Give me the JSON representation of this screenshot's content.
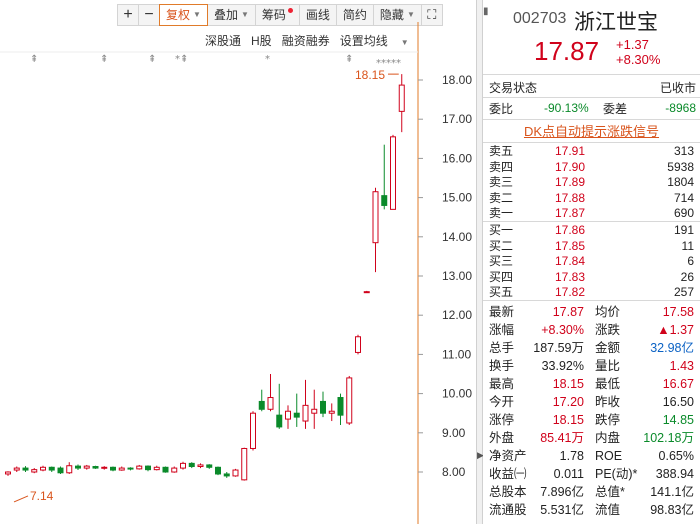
{
  "toolbar": {
    "plus": "+",
    "minus": "−",
    "fuquan": "复权",
    "diejia": "叠加",
    "choumao": "筹码",
    "huaxian": "画线",
    "jianyue": "简约",
    "yincang": "隐藏"
  },
  "subbar": {
    "shengang": "深股通",
    "hgu": "H股",
    "rongzi": "融资融券",
    "junxian": "设置均线"
  },
  "axis": {
    "labels": [
      "18.00",
      "17.00",
      "16.00",
      "15.00",
      "14.00",
      "13.00",
      "12.00",
      "11.00",
      "10.00",
      "9.00",
      "8.00"
    ]
  },
  "annotations": {
    "high": "18.15",
    "low": "7.14",
    "stars": "*****",
    "marks": [
      "⇞",
      "⇞",
      "⇞",
      "*⇞",
      "*",
      "⇞"
    ]
  },
  "header": {
    "code": "002703",
    "name": "浙江世宝",
    "price": "17.87",
    "change": "+1.37",
    "change_pct": "+8.30%"
  },
  "status": {
    "label": "交易状态",
    "value": "已收市"
  },
  "ratio": {
    "weibi_label": "委比",
    "weibi": "-90.13%",
    "weicha_label": "委差",
    "weicha": "-8968"
  },
  "dk_signal": "DK点自动提示涨跌信号",
  "sells": [
    {
      "label": "卖五",
      "price": "17.91",
      "vol": "313"
    },
    {
      "label": "卖四",
      "price": "17.90",
      "vol": "5938"
    },
    {
      "label": "卖三",
      "price": "17.89",
      "vol": "1804"
    },
    {
      "label": "卖二",
      "price": "17.88",
      "vol": "714"
    },
    {
      "label": "卖一",
      "price": "17.87",
      "vol": "690"
    }
  ],
  "buys": [
    {
      "label": "买一",
      "price": "17.86",
      "vol": "191"
    },
    {
      "label": "买二",
      "price": "17.85",
      "vol": "11"
    },
    {
      "label": "买三",
      "price": "17.84",
      "vol": "6"
    },
    {
      "label": "买四",
      "price": "17.83",
      "vol": "26"
    },
    {
      "label": "买五",
      "price": "17.82",
      "vol": "257"
    }
  ],
  "stats": [
    {
      "l1": "最新",
      "v1": "17.87",
      "c1": "red",
      "l2": "均价",
      "v2": "17.58",
      "c2": "red"
    },
    {
      "l1": "涨幅",
      "v1": "+8.30%",
      "c1": "red",
      "l2": "涨跌",
      "v2": "▲1.37",
      "c2": "red"
    },
    {
      "l1": "总手",
      "v1": "187.59万",
      "c1": "blk",
      "l2": "金额",
      "v2": "32.98亿",
      "c2": "blue"
    },
    {
      "l1": "换手",
      "v1": "33.92%",
      "c1": "blk",
      "l2": "量比",
      "v2": "1.43",
      "c2": "red"
    },
    {
      "l1": "最高",
      "v1": "18.15",
      "c1": "red",
      "l2": "最低",
      "v2": "16.67",
      "c2": "red"
    },
    {
      "l1": "今开",
      "v1": "17.20",
      "c1": "red",
      "l2": "昨收",
      "v2": "16.50",
      "c2": "blk"
    },
    {
      "l1": "涨停",
      "v1": "18.15",
      "c1": "red",
      "l2": "跌停",
      "v2": "14.85",
      "c2": "green"
    },
    {
      "l1": "外盘",
      "v1": "85.41万",
      "c1": "red",
      "l2": "内盘",
      "v2": "102.18万",
      "c2": "green"
    },
    {
      "l1": "净资产",
      "v1": "1.78",
      "c1": "blk",
      "l2": "ROE",
      "v2": "0.65%",
      "c2": "blk"
    },
    {
      "l1": "收益㈠",
      "v1": "0.011",
      "c1": "blk",
      "l2": "PE(动)*",
      "v2": "388.94",
      "c2": "blk"
    },
    {
      "l1": "总股本",
      "v1": "7.896亿",
      "c1": "blk",
      "l2": "总值*",
      "v2": "141.1亿",
      "c2": "blk"
    },
    {
      "l1": "流通股",
      "v1": "5.531亿",
      "c1": "blk",
      "l2": "流值",
      "v2": "98.83亿",
      "c2": "blk"
    }
  ],
  "candles": [
    {
      "o": 7.95,
      "c": 8.0,
      "h": 8.02,
      "l": 7.9
    },
    {
      "o": 8.05,
      "c": 8.1,
      "h": 8.14,
      "l": 8.0
    },
    {
      "o": 8.1,
      "c": 8.05,
      "h": 8.15,
      "l": 8.0
    },
    {
      "o": 8.0,
      "c": 8.06,
      "h": 8.1,
      "l": 7.97
    },
    {
      "o": 8.05,
      "c": 8.12,
      "h": 8.16,
      "l": 8.02
    },
    {
      "o": 8.12,
      "c": 8.05,
      "h": 8.14,
      "l": 8.0
    },
    {
      "o": 8.1,
      "c": 7.98,
      "h": 8.14,
      "l": 7.95
    },
    {
      "o": 7.98,
      "c": 8.16,
      "h": 8.25,
      "l": 7.95
    },
    {
      "o": 8.15,
      "c": 8.1,
      "h": 8.19,
      "l": 8.05
    },
    {
      "o": 8.1,
      "c": 8.15,
      "h": 8.18,
      "l": 8.06
    },
    {
      "o": 8.14,
      "c": 8.1,
      "h": 8.16,
      "l": 8.08
    },
    {
      "o": 8.1,
      "c": 8.12,
      "h": 8.15,
      "l": 8.06
    },
    {
      "o": 8.12,
      "c": 8.05,
      "h": 8.14,
      "l": 8.02
    },
    {
      "o": 8.05,
      "c": 8.1,
      "h": 8.14,
      "l": 8.03
    },
    {
      "o": 8.1,
      "c": 8.08,
      "h": 8.12,
      "l": 8.04
    },
    {
      "o": 8.08,
      "c": 8.15,
      "h": 8.18,
      "l": 8.06
    },
    {
      "o": 8.15,
      "c": 8.06,
      "h": 8.17,
      "l": 8.02
    },
    {
      "o": 8.06,
      "c": 8.12,
      "h": 8.16,
      "l": 8.04
    },
    {
      "o": 8.12,
      "c": 8.0,
      "h": 8.14,
      "l": 7.98
    },
    {
      "o": 8.0,
      "c": 8.1,
      "h": 8.14,
      "l": 7.98
    },
    {
      "o": 8.1,
      "c": 8.22,
      "h": 8.26,
      "l": 8.06
    },
    {
      "o": 8.22,
      "c": 8.14,
      "h": 8.25,
      "l": 8.1
    },
    {
      "o": 8.14,
      "c": 8.18,
      "h": 8.22,
      "l": 8.1
    },
    {
      "o": 8.18,
      "c": 8.12,
      "h": 8.2,
      "l": 8.08
    },
    {
      "o": 8.12,
      "c": 7.95,
      "h": 8.14,
      "l": 7.92
    },
    {
      "o": 7.95,
      "c": 7.9,
      "h": 8.0,
      "l": 7.85
    },
    {
      "o": 7.9,
      "c": 8.05,
      "h": 8.08,
      "l": 7.88
    },
    {
      "o": 7.8,
      "c": 8.6,
      "h": 8.62,
      "l": 7.78
    },
    {
      "o": 8.6,
      "c": 9.5,
      "h": 9.55,
      "l": 8.55
    },
    {
      "o": 9.8,
      "c": 9.6,
      "h": 10.1,
      "l": 9.55
    },
    {
      "o": 9.6,
      "c": 9.9,
      "h": 10.5,
      "l": 9.55
    },
    {
      "o": 9.45,
      "c": 9.15,
      "h": 10.25,
      "l": 9.1
    },
    {
      "o": 9.35,
      "c": 9.55,
      "h": 9.7,
      "l": 9.1
    },
    {
      "o": 9.5,
      "c": 9.4,
      "h": 10.0,
      "l": 9.15
    },
    {
      "o": 9.3,
      "c": 9.7,
      "h": 10.35,
      "l": 9.1
    },
    {
      "o": 9.5,
      "c": 9.6,
      "h": 10.1,
      "l": 9.1
    },
    {
      "o": 9.8,
      "c": 9.5,
      "h": 10.05,
      "l": 9.4
    },
    {
      "o": 9.5,
      "c": 9.55,
      "h": 9.75,
      "l": 9.3
    },
    {
      "o": 9.9,
      "c": 9.45,
      "h": 10.0,
      "l": 9.2
    },
    {
      "o": 9.25,
      "c": 10.4,
      "h": 10.45,
      "l": 9.2
    },
    {
      "o": 11.05,
      "c": 11.45,
      "h": 11.5,
      "l": 11.0
    },
    {
      "o": 12.6,
      "c": 12.6,
      "h": 12.62,
      "l": 12.58
    },
    {
      "o": 13.85,
      "c": 15.15,
      "h": 15.25,
      "l": 13.1
    },
    {
      "o": 15.05,
      "c": 14.8,
      "h": 16.35,
      "l": 14.7
    },
    {
      "o": 14.7,
      "c": 16.55,
      "h": 16.6,
      "l": 14.7
    },
    {
      "o": 17.2,
      "c": 17.87,
      "h": 18.15,
      "l": 16.67
    }
  ],
  "colors": {
    "up": "#d0021b",
    "down": "#0a8a2a",
    "accent": "#d9541c"
  }
}
